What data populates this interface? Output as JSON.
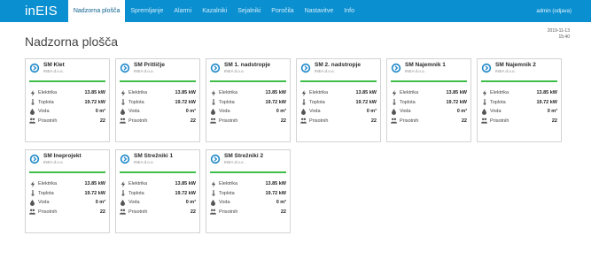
{
  "app": {
    "logo": "inEIS",
    "nav": [
      "Nadzorna plošča",
      "Spremljanje",
      "Alarmi",
      "Kazalniki",
      "Sejalniki",
      "Poročila",
      "Nastavitve",
      "Info"
    ],
    "user": "admin (odjava)"
  },
  "page": {
    "title": "Nadzorna plošča",
    "date": "2019-11-13",
    "time": "15:40"
  },
  "labels": {
    "elektrika": "Elektrika",
    "toplota": "Toplota",
    "voda": "Voda",
    "prisotnih": "Prisotnih"
  },
  "icons": {
    "card": "circle-arrow-icon",
    "elektrika": "lightning-icon",
    "toplota": "thermometer-icon",
    "voda": "water-drop-icon",
    "prisotnih": "people-icon"
  },
  "colors": {
    "topbar": "#0a8fd0",
    "accent_rule": "#3fbf4a",
    "card_icon": "#1e88c8"
  },
  "cards": [
    {
      "title": "SM Klet",
      "subtitle": "INEA d.o.o.",
      "elektrika": "13.85 kW",
      "toplota": "19.72 kW",
      "voda": "0 m³",
      "prisotnih": "22"
    },
    {
      "title": "SM Pritličje",
      "subtitle": "INEA d.o.o.",
      "elektrika": "13.85 kW",
      "toplota": "19.72 kW",
      "voda": "0 m³",
      "prisotnih": "22"
    },
    {
      "title": "SM 1. nadstropje",
      "subtitle": "INEA d.o.o.",
      "elektrika": "13.85 kW",
      "toplota": "19.72 kW",
      "voda": "0 m³",
      "prisotnih": "22"
    },
    {
      "title": "SM 2. nadstropje",
      "subtitle": "INEA d.o.o.",
      "elektrika": "13.85 kW",
      "toplota": "19.72 kW",
      "voda": "0 m³",
      "prisotnih": "22"
    },
    {
      "title": "SM Najemnik 1",
      "subtitle": "INEA d.o.o.",
      "elektrika": "13.85 kW",
      "toplota": "19.72 kW",
      "voda": "0 m³",
      "prisotnih": "22"
    },
    {
      "title": "SM Najemnik 2",
      "subtitle": "INEA d.o.o.",
      "elektrika": "13.85 kW",
      "toplota": "19.72 kW",
      "voda": "0 m³",
      "prisotnih": "22"
    },
    {
      "title": "SM Ineprojekt",
      "subtitle": "INEA d.o.o.",
      "elektrika": "13.85 kW",
      "toplota": "19.72 kW",
      "voda": "0 m³",
      "prisotnih": "22"
    },
    {
      "title": "SM Strežniki 1",
      "subtitle": "INEA d.o.o.",
      "elektrika": "13.85 kW",
      "toplota": "19.72 kW",
      "voda": "0 m³",
      "prisotnih": "22"
    },
    {
      "title": "SM Strežniki 2",
      "subtitle": "INEA d.o.o.",
      "elektrika": "13.85 kW",
      "toplota": "19.72 kW",
      "voda": "0 m³",
      "prisotnih": "22"
    }
  ]
}
